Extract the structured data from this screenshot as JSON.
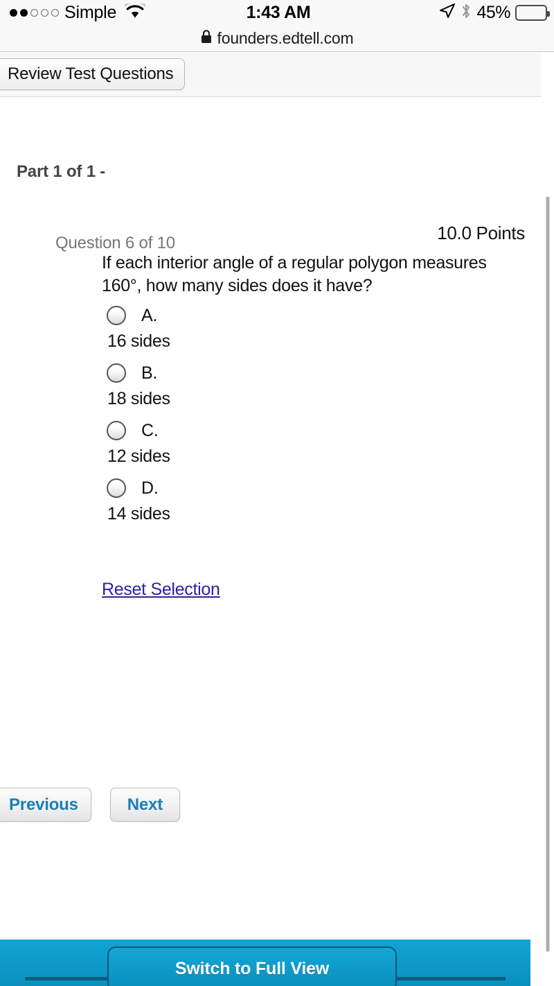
{
  "status_bar": {
    "signal_dots_filled": 2,
    "signal_dots_total": 5,
    "carrier": "Simple",
    "wifi_icon": "wifi-icon",
    "time": "1:43 AM",
    "location_icon": "location-arrow-icon",
    "bluetooth_icon": "bluetooth-icon",
    "battery_percent": "45%",
    "battery_level": 45,
    "battery_color": "#ffcc00"
  },
  "url_bar": {
    "lock_icon": "lock-icon",
    "url": "founders.edtell.com"
  },
  "nav_bar": {
    "review_tab_label": "Review Test Questions"
  },
  "page": {
    "part_heading": "Part 1 of 1 -",
    "question": {
      "number_label": "Question 6 of 10",
      "points_label": "10.0 Points",
      "text": "If each interior angle of a regular polygon measures 160°, how many sides does it have?",
      "options": [
        {
          "letter": "A.",
          "text": "16 sides",
          "selected": false
        },
        {
          "letter": "B.",
          "text": "18 sides",
          "selected": false
        },
        {
          "letter": "C.",
          "text": "12 sides",
          "selected": false
        },
        {
          "letter": "D.",
          "text": "14 sides",
          "selected": false
        }
      ],
      "reset_link_label": "Reset Selection",
      "link_color": "#2b21a8"
    },
    "navigation": {
      "previous_label": "Previous",
      "next_label": "Next",
      "button_text_color": "#1a7fb5"
    }
  },
  "bottom_bar": {
    "switch_label": "Switch to Full View",
    "bar_color": "#0e9ccb"
  }
}
